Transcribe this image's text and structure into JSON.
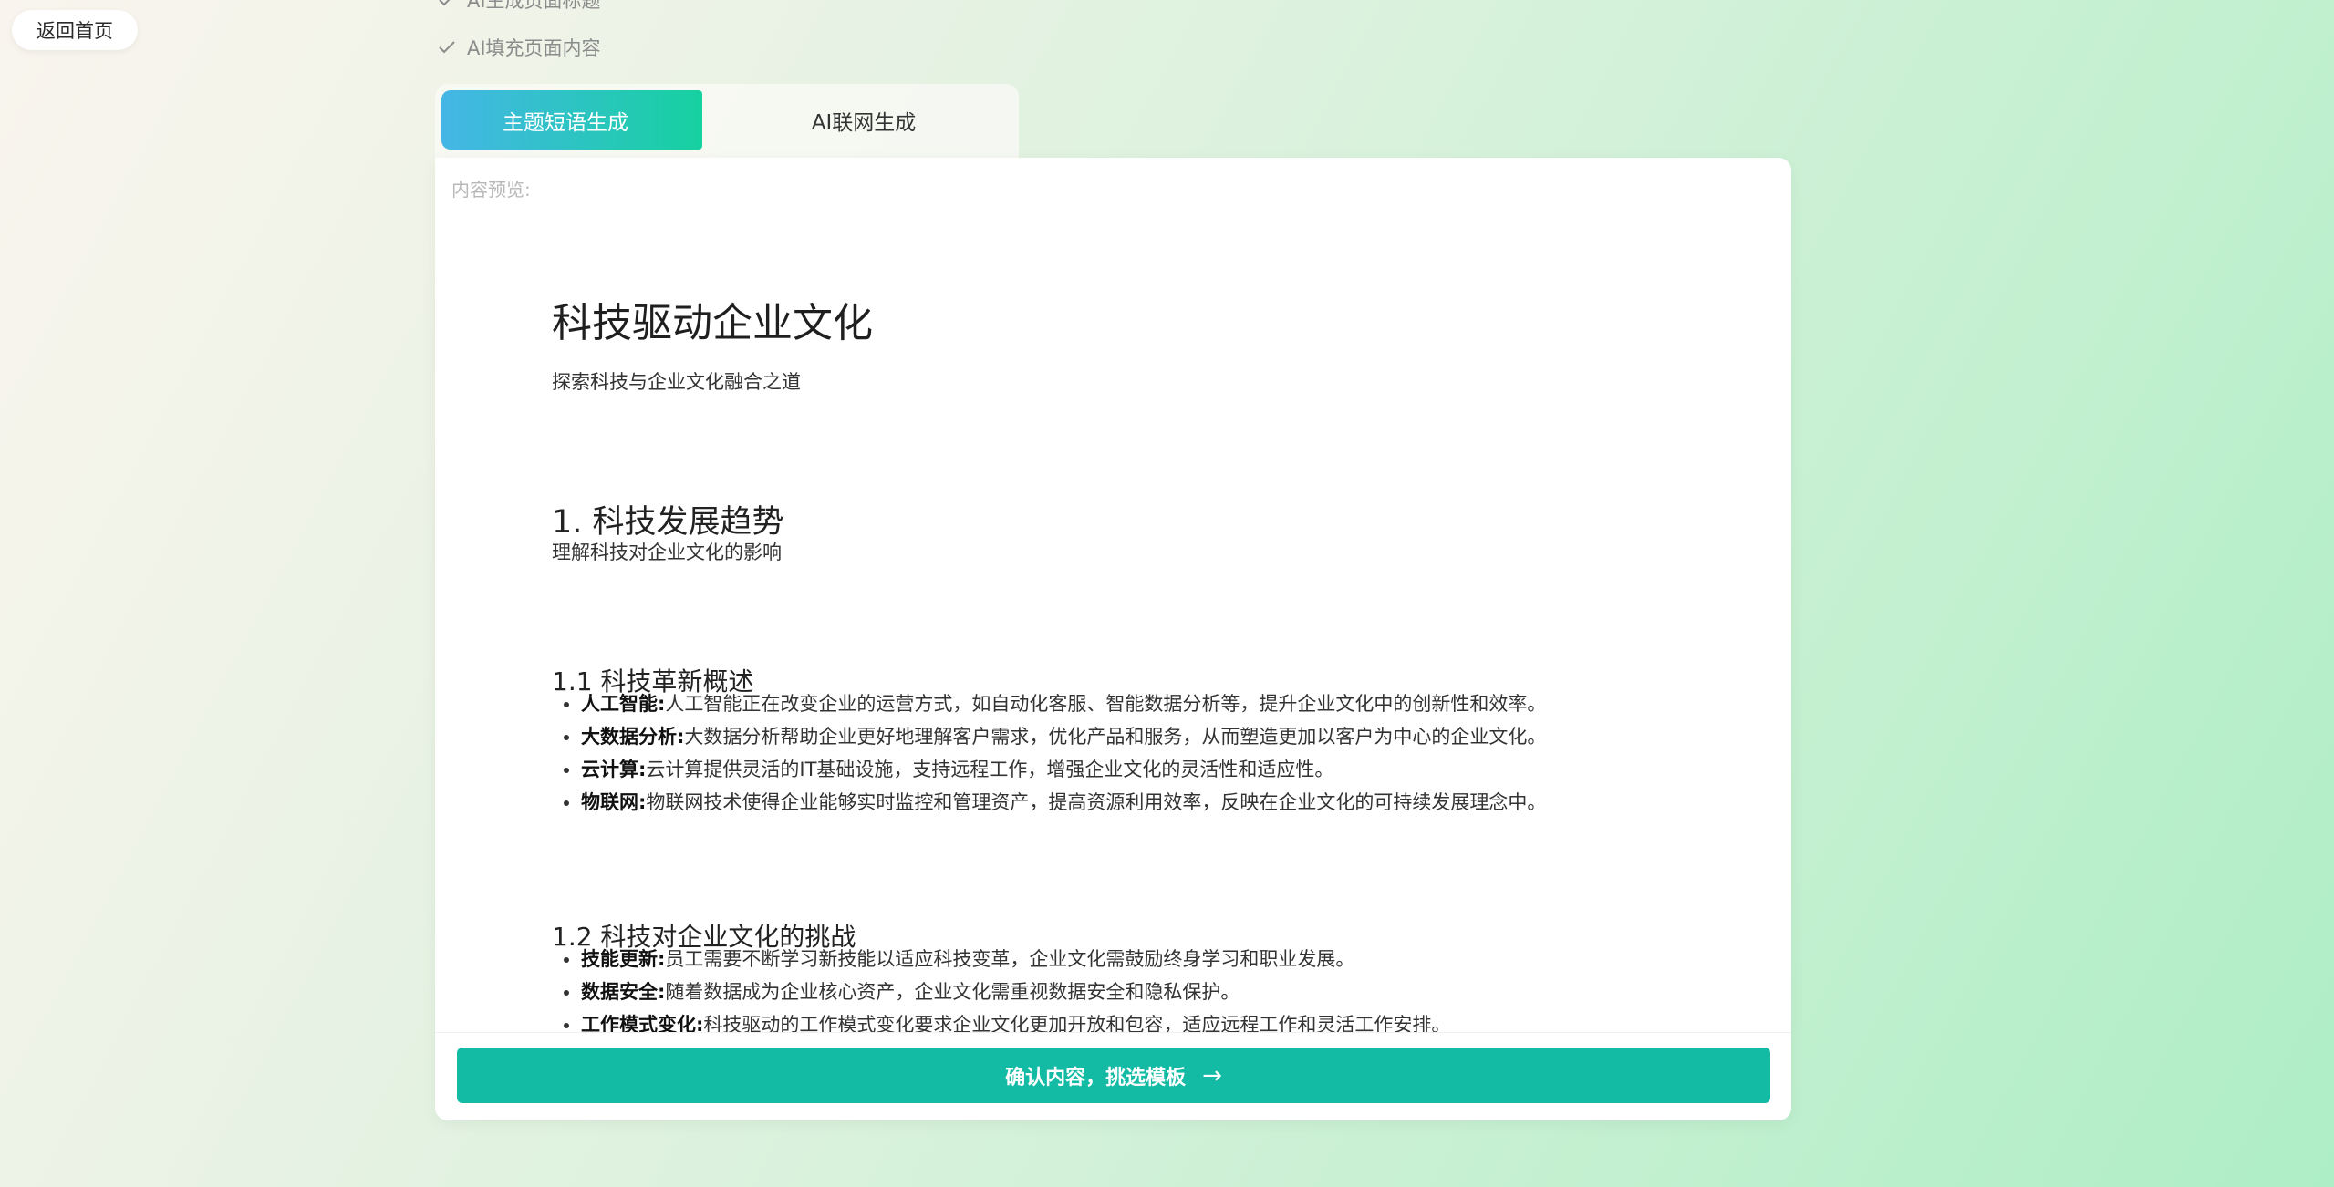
{
  "nav": {
    "back_label": "返回首页"
  },
  "steps": [
    {
      "label": "AI生成页面标题"
    },
    {
      "label": "AI填充页面内容"
    }
  ],
  "tabs": [
    {
      "label": "主题短语生成",
      "active": true
    },
    {
      "label": "AI联网生成",
      "active": false
    }
  ],
  "preview": {
    "label": "内容预览:",
    "title": "科技驱动企业文化",
    "subtitle": "探索科技与企业文化融合之道",
    "section1": {
      "heading": "1. 科技发展趋势",
      "desc": "理解科技对企业文化的影响",
      "sub1": {
        "heading": "1.1 科技革新概述",
        "items": [
          {
            "term": "人工智能:",
            "text": "人工智能正在改变企业的运营方式，如自动化客服、智能数据分析等，提升企业文化中的创新性和效率。"
          },
          {
            "term": "大数据分析:",
            "text": "大数据分析帮助企业更好地理解客户需求，优化产品和服务，从而塑造更加以客户为中心的企业文化。"
          },
          {
            "term": "云计算:",
            "text": "云计算提供灵活的IT基础设施，支持远程工作，增强企业文化的灵活性和适应性。"
          },
          {
            "term": "物联网:",
            "text": "物联网技术使得企业能够实时监控和管理资产，提高资源利用效率，反映在企业文化的可持续发展理念中。"
          }
        ]
      },
      "sub2": {
        "heading": "1.2 科技对企业文化的挑战",
        "items": [
          {
            "term": "技能更新:",
            "text": "员工需要不断学习新技能以适应科技变革，企业文化需鼓励终身学习和职业发展。"
          },
          {
            "term": "数据安全:",
            "text": "随着数据成为企业核心资产，企业文化需重视数据安全和隐私保护。"
          },
          {
            "term": "工作模式变化:",
            "text": "科技驱动的工作模式变化要求企业文化更加开放和包容，适应远程工作和灵活工作安排。"
          }
        ]
      }
    }
  },
  "actions": {
    "confirm_label": "确认内容，挑选模板",
    "confirm_arrow": "→"
  }
}
